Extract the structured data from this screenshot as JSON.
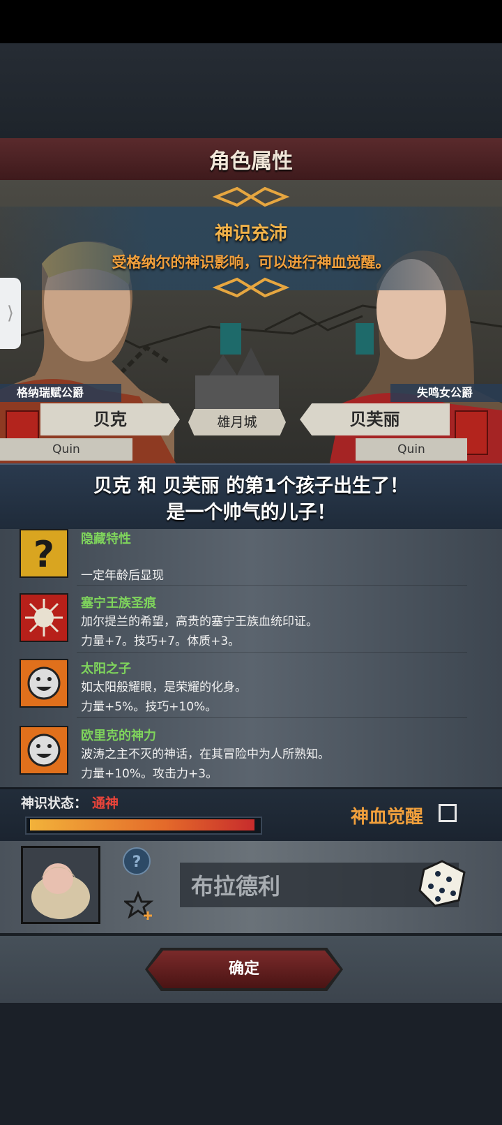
{
  "header": {
    "title": "角色属性"
  },
  "blessing": {
    "title": "神识充沛",
    "description": "受格纳尔的神识影响，可以进行神血觉醒。"
  },
  "scene": {
    "castle_name": "雄月城",
    "father": {
      "title": "格纳瑞赋公爵",
      "name": "贝克",
      "trait": "Quin"
    },
    "mother": {
      "title": "失鸣女公爵",
      "name": "贝芙丽",
      "trait": "Quin"
    }
  },
  "announcement": {
    "line1": "贝克 和 贝芙丽 的第1个孩子出生了！",
    "line2": "是一个帅气的儿子！"
  },
  "traits": [
    {
      "name": "隐藏特性",
      "desc1": "",
      "desc2": "一定年龄后显现",
      "icon": "question-icon"
    },
    {
      "name": "塞宁王族圣痕",
      "desc1": "加尔提兰的希望，高贵的塞宁王族血统印证。",
      "desc2": "力量+7。技巧+7。体质+3。",
      "icon": "sun-emblem-icon"
    },
    {
      "name": "太阳之子",
      "desc1": "如太阳般耀眼，是荣耀的化身。",
      "desc2": "力量+5%。技巧+10%。",
      "icon": "smiley-icon"
    },
    {
      "name": "欧里克的神力",
      "desc1": "波涛之主不灭的神话，在其冒险中为人所熟知。",
      "desc2": "力量+10%。攻击力+3。",
      "icon": "smiley-icon"
    }
  ],
  "divine_status": {
    "label": "神识状态：",
    "value": "通神",
    "progress": 1.0,
    "awaken_label": "神血觉醒",
    "awaken_checked": false
  },
  "naming": {
    "name_value": "布拉德利",
    "help_symbol": "?"
  },
  "footer": {
    "confirm_label": "确定"
  },
  "colors": {
    "accent_orange": "#f2a03c",
    "trait_green": "#7fd45c",
    "status_red": "#e9443a"
  }
}
